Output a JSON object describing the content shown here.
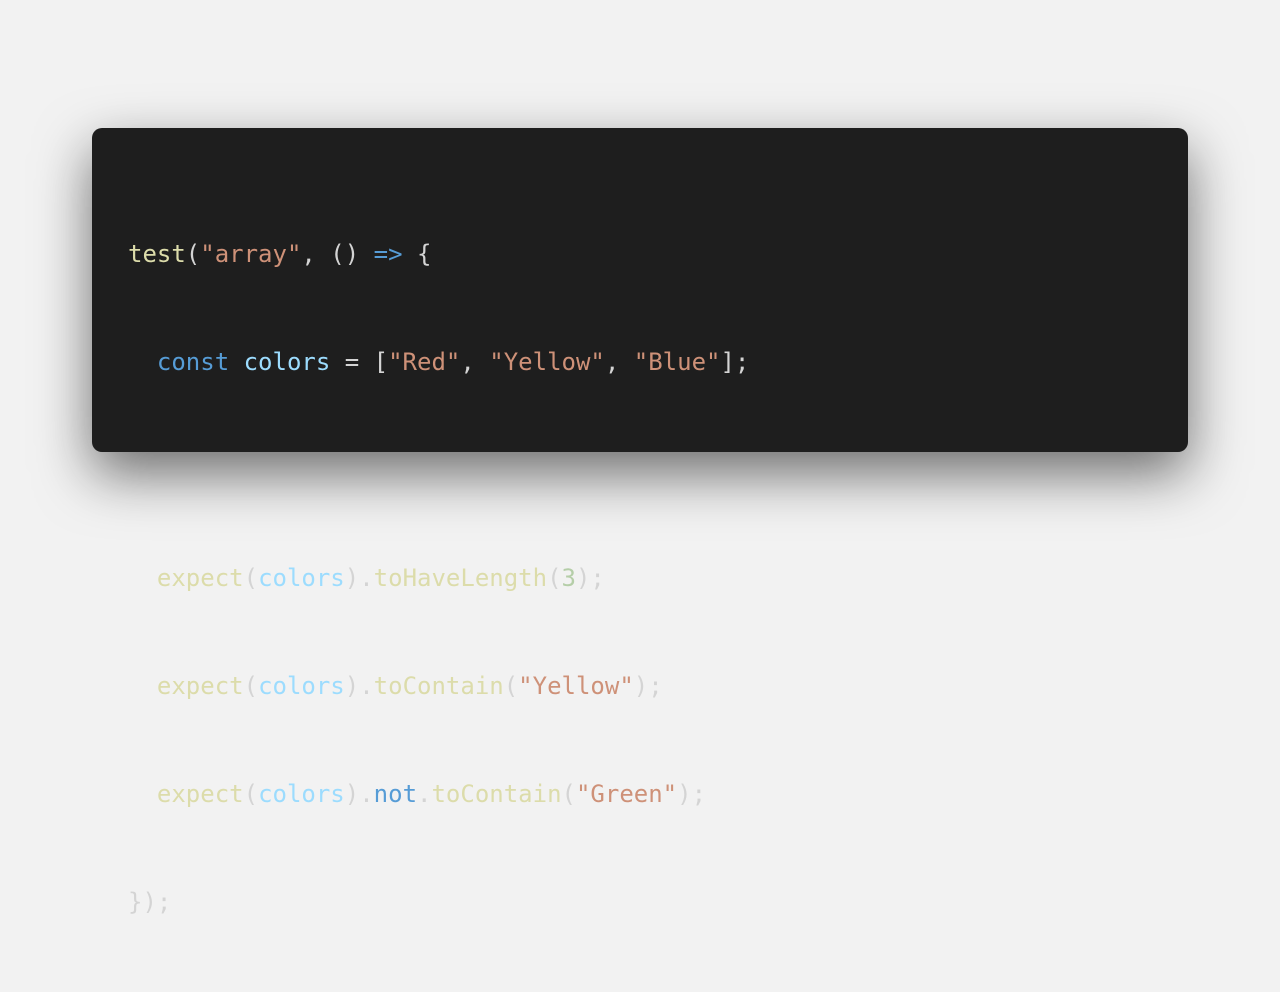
{
  "colors": {
    "page_background": "#f2f2f2",
    "editor_background": "#1e1e1e",
    "function": "#dcdcaa",
    "string": "#ce9178",
    "keyword": "#569cd6",
    "variable": "#9cdcfe",
    "number": "#b5cea8",
    "punctuation": "#d4d4d4"
  },
  "code": {
    "line1": {
      "fn": "test",
      "open_paren": "(",
      "name_str": "\"array\"",
      "comma_arrow_args": ", () ",
      "arrow": "=>",
      "brace": " {"
    },
    "line2": {
      "indent": "  ",
      "kw": "const",
      "space": " ",
      "var": "colors",
      "assign": " = [",
      "s1": "\"Red\"",
      "c1": ", ",
      "s2": "\"Yellow\"",
      "c2": ", ",
      "s3": "\"Blue\"",
      "end": "];"
    },
    "line4": {
      "indent": "  ",
      "fn": "expect",
      "p1": "(",
      "var": "colors",
      "p2": ").",
      "method": "toHaveLength",
      "p3": "(",
      "num": "3",
      "end": ");"
    },
    "line5": {
      "indent": "  ",
      "fn": "expect",
      "p1": "(",
      "var": "colors",
      "p2": ").",
      "method": "toContain",
      "p3": "(",
      "str": "\"Yellow\"",
      "end": ");"
    },
    "line6": {
      "indent": "  ",
      "fn": "expect",
      "p1": "(",
      "var": "colors",
      "p2": ").",
      "kw": "not",
      "dot": ".",
      "method": "toContain",
      "p3": "(",
      "str": "\"Green\"",
      "end": ");"
    },
    "line7": {
      "close": "});"
    }
  }
}
